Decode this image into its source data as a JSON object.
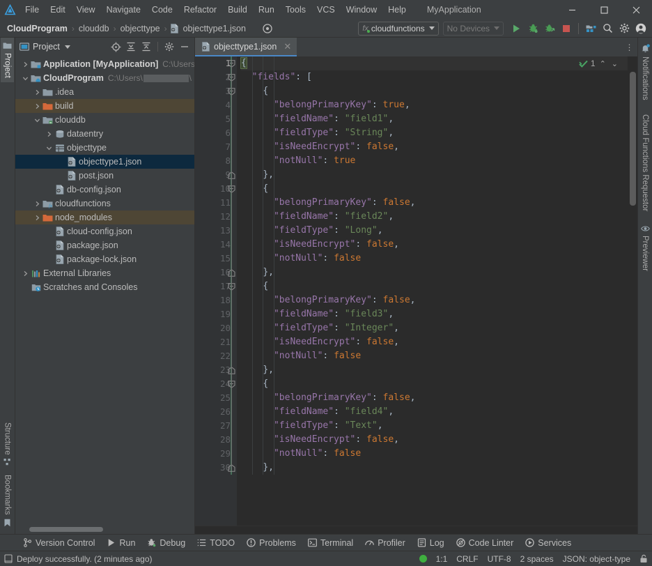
{
  "window": {
    "app_title": "MyApplication",
    "minimize_label": "—",
    "maximize_label": "□",
    "close_label": "✕"
  },
  "menu": {
    "items": [
      {
        "label": "File"
      },
      {
        "label": "Edit"
      },
      {
        "label": "View"
      },
      {
        "label": "Navigate"
      },
      {
        "label": "Code"
      },
      {
        "label": "Refactor"
      },
      {
        "label": "Build"
      },
      {
        "label": "Run"
      },
      {
        "label": "Tools"
      },
      {
        "label": "VCS"
      },
      {
        "label": "Window"
      },
      {
        "label": "Help"
      }
    ]
  },
  "navbar": {
    "breadcrumbs": [
      {
        "label": "CloudProgram",
        "bold": true,
        "icon": ""
      },
      {
        "label": "clouddb",
        "bold": false,
        "icon": ""
      },
      {
        "label": "objecttype",
        "bold": false,
        "icon": ""
      },
      {
        "label": "objecttype1.json",
        "bold": false,
        "icon": "json-file-icon"
      }
    ],
    "separator": "›",
    "run_config": "cloudfunctions",
    "run_config_prefix": "fx",
    "device_selector": "No Devices",
    "buttons": [
      {
        "name": "run-button",
        "icon": "run-icon"
      },
      {
        "name": "debug-button",
        "icon": "debug-icon"
      },
      {
        "name": "attach-debugger-button",
        "icon": "attach-debugger-icon"
      },
      {
        "name": "stop-button",
        "icon": "stop-icon"
      },
      {
        "name": "project-structure-button",
        "icon": "project-structure-icon"
      },
      {
        "name": "search-everywhere-button",
        "icon": "search-icon"
      },
      {
        "name": "settings-button",
        "icon": "gear-icon"
      },
      {
        "name": "account-button",
        "icon": "avatar-icon"
      }
    ]
  },
  "left_rail": {
    "top": [
      {
        "label": "Project",
        "active": true
      }
    ],
    "bottom": [
      {
        "label": "Structure",
        "active": false
      },
      {
        "label": "Bookmarks",
        "active": false
      }
    ]
  },
  "right_rail": {
    "items": [
      {
        "label": "Notifications"
      },
      {
        "label": "Cloud Functions Requestor"
      },
      {
        "label": "Previewer"
      }
    ]
  },
  "project_panel": {
    "title": "Project",
    "tools": [
      {
        "name": "select-opened-file-icon"
      },
      {
        "name": "expand-all-icon"
      },
      {
        "name": "collapse-all-icon"
      },
      {
        "name": "gear-icon"
      },
      {
        "name": "hide-panel-icon"
      }
    ],
    "tree": [
      {
        "indent": 0,
        "arrow": "right",
        "icon": "module-icon",
        "label": "Application [MyApplication]",
        "bold": true,
        "path": "C:\\Users",
        "state": "none",
        "redacted": false
      },
      {
        "indent": 0,
        "arrow": "down",
        "icon": "cloud-module-icon",
        "label": "CloudProgram",
        "bold": true,
        "path": "C:\\Users\\",
        "state": "none",
        "redacted": true
      },
      {
        "indent": 1,
        "arrow": "right",
        "icon": "folder-icon",
        "label": ".idea",
        "bold": false,
        "path": "",
        "state": "none",
        "redacted": false
      },
      {
        "indent": 1,
        "arrow": "right",
        "icon": "orange-folder-icon",
        "label": "build",
        "bold": false,
        "path": "",
        "state": "hl",
        "redacted": false
      },
      {
        "indent": 1,
        "arrow": "down",
        "icon": "db-module-icon",
        "label": "clouddb",
        "bold": false,
        "path": "",
        "state": "none",
        "redacted": false
      },
      {
        "indent": 2,
        "arrow": "right",
        "icon": "dataentry-icon",
        "label": "dataentry",
        "bold": false,
        "path": "",
        "state": "none",
        "redacted": false
      },
      {
        "indent": 2,
        "arrow": "down",
        "icon": "objecttype-icon",
        "label": "objecttype",
        "bold": false,
        "path": "",
        "state": "none",
        "redacted": false
      },
      {
        "indent": 3,
        "arrow": "none",
        "icon": "json-file-icon",
        "label": "objecttype1.json",
        "bold": false,
        "path": "",
        "state": "sel",
        "redacted": false
      },
      {
        "indent": 3,
        "arrow": "none",
        "icon": "json-file-icon",
        "label": "post.json",
        "bold": false,
        "path": "",
        "state": "none",
        "redacted": false
      },
      {
        "indent": 2,
        "arrow": "none",
        "icon": "json-file-icon",
        "label": "db-config.json",
        "bold": false,
        "path": "",
        "state": "none",
        "redacted": false
      },
      {
        "indent": 1,
        "arrow": "right",
        "icon": "fn-module-icon",
        "label": "cloudfunctions",
        "bold": false,
        "path": "",
        "state": "none",
        "redacted": false
      },
      {
        "indent": 1,
        "arrow": "right",
        "icon": "orange-folder-icon",
        "label": "node_modules",
        "bold": false,
        "path": "",
        "state": "hl",
        "redacted": false
      },
      {
        "indent": 2,
        "arrow": "none",
        "icon": "json-file-icon",
        "label": "cloud-config.json",
        "bold": false,
        "path": "",
        "state": "none",
        "redacted": false
      },
      {
        "indent": 2,
        "arrow": "none",
        "icon": "json-file-icon",
        "label": "package.json",
        "bold": false,
        "path": "",
        "state": "none",
        "redacted": false
      },
      {
        "indent": 2,
        "arrow": "none",
        "icon": "json-file-icon",
        "label": "package-lock.json",
        "bold": false,
        "path": "",
        "state": "none",
        "redacted": false
      },
      {
        "indent": 0,
        "arrow": "right",
        "icon": "libraries-icon",
        "label": "External Libraries",
        "bold": false,
        "path": "",
        "state": "none",
        "redacted": false
      },
      {
        "indent": 0,
        "arrow": "none",
        "icon": "scratches-icon",
        "label": "Scratches and Consoles",
        "bold": false,
        "path": "",
        "state": "none",
        "redacted": false
      }
    ]
  },
  "editor": {
    "tab": {
      "label": "objecttype1.json",
      "icon": "json-file-icon",
      "close": "✕"
    },
    "more_actions": "⋮",
    "inspections": {
      "count": "1",
      "icon": "inspection-ok-icon",
      "prev": "⌃",
      "next": "⌄"
    },
    "first_line_number": 1,
    "lines": [
      {
        "n": 1,
        "fold": "open",
        "tokens": [
          {
            "t": "{",
            "c": "p"
          }
        ],
        "indent": 0,
        "cursor": true
      },
      {
        "n": 2,
        "fold": "open",
        "tokens": [
          {
            "t": "\"fields\"",
            "c": "k"
          },
          {
            "t": ": ",
            "c": "p"
          },
          {
            "t": "[",
            "c": "p"
          }
        ],
        "indent": 1
      },
      {
        "n": 3,
        "fold": "open",
        "tokens": [
          {
            "t": "{",
            "c": "p"
          }
        ],
        "indent": 2
      },
      {
        "n": 4,
        "fold": "",
        "tokens": [
          {
            "t": "\"belongPrimaryKey\"",
            "c": "k"
          },
          {
            "t": ": ",
            "c": "p"
          },
          {
            "t": "true",
            "c": "b"
          },
          {
            "t": ",",
            "c": "p"
          }
        ],
        "indent": 3
      },
      {
        "n": 5,
        "fold": "",
        "tokens": [
          {
            "t": "\"fieldName\"",
            "c": "k"
          },
          {
            "t": ": ",
            "c": "p"
          },
          {
            "t": "\"field1\"",
            "c": "s"
          },
          {
            "t": ",",
            "c": "p"
          }
        ],
        "indent": 3
      },
      {
        "n": 6,
        "fold": "",
        "tokens": [
          {
            "t": "\"fieldType\"",
            "c": "k"
          },
          {
            "t": ": ",
            "c": "p"
          },
          {
            "t": "\"String\"",
            "c": "s"
          },
          {
            "t": ",",
            "c": "p"
          }
        ],
        "indent": 3
      },
      {
        "n": 7,
        "fold": "",
        "tokens": [
          {
            "t": "\"isNeedEncrypt\"",
            "c": "k"
          },
          {
            "t": ": ",
            "c": "p"
          },
          {
            "t": "false",
            "c": "b"
          },
          {
            "t": ",",
            "c": "p"
          }
        ],
        "indent": 3
      },
      {
        "n": 8,
        "fold": "",
        "tokens": [
          {
            "t": "\"notNull\"",
            "c": "k"
          },
          {
            "t": ": ",
            "c": "p"
          },
          {
            "t": "true",
            "c": "b"
          }
        ],
        "indent": 3
      },
      {
        "n": 9,
        "fold": "close",
        "tokens": [
          {
            "t": "},",
            "c": "p"
          }
        ],
        "indent": 2
      },
      {
        "n": 10,
        "fold": "open",
        "tokens": [
          {
            "t": "{",
            "c": "p"
          }
        ],
        "indent": 2
      },
      {
        "n": 11,
        "fold": "",
        "tokens": [
          {
            "t": "\"belongPrimaryKey\"",
            "c": "k"
          },
          {
            "t": ": ",
            "c": "p"
          },
          {
            "t": "false",
            "c": "b"
          },
          {
            "t": ",",
            "c": "p"
          }
        ],
        "indent": 3
      },
      {
        "n": 12,
        "fold": "",
        "tokens": [
          {
            "t": "\"fieldName\"",
            "c": "k"
          },
          {
            "t": ": ",
            "c": "p"
          },
          {
            "t": "\"field2\"",
            "c": "s"
          },
          {
            "t": ",",
            "c": "p"
          }
        ],
        "indent": 3
      },
      {
        "n": 13,
        "fold": "",
        "tokens": [
          {
            "t": "\"fieldType\"",
            "c": "k"
          },
          {
            "t": ": ",
            "c": "p"
          },
          {
            "t": "\"Long\"",
            "c": "s"
          },
          {
            "t": ",",
            "c": "p"
          }
        ],
        "indent": 3
      },
      {
        "n": 14,
        "fold": "",
        "tokens": [
          {
            "t": "\"isNeedEncrypt\"",
            "c": "k"
          },
          {
            "t": ": ",
            "c": "p"
          },
          {
            "t": "false",
            "c": "b"
          },
          {
            "t": ",",
            "c": "p"
          }
        ],
        "indent": 3
      },
      {
        "n": 15,
        "fold": "",
        "tokens": [
          {
            "t": "\"notNull\"",
            "c": "k"
          },
          {
            "t": ": ",
            "c": "p"
          },
          {
            "t": "false",
            "c": "b"
          }
        ],
        "indent": 3
      },
      {
        "n": 16,
        "fold": "close",
        "tokens": [
          {
            "t": "},",
            "c": "p"
          }
        ],
        "indent": 2
      },
      {
        "n": 17,
        "fold": "open",
        "tokens": [
          {
            "t": "{",
            "c": "p"
          }
        ],
        "indent": 2
      },
      {
        "n": 18,
        "fold": "",
        "tokens": [
          {
            "t": "\"belongPrimaryKey\"",
            "c": "k"
          },
          {
            "t": ": ",
            "c": "p"
          },
          {
            "t": "false",
            "c": "b"
          },
          {
            "t": ",",
            "c": "p"
          }
        ],
        "indent": 3
      },
      {
        "n": 19,
        "fold": "",
        "tokens": [
          {
            "t": "\"fieldName\"",
            "c": "k"
          },
          {
            "t": ": ",
            "c": "p"
          },
          {
            "t": "\"field3\"",
            "c": "s"
          },
          {
            "t": ",",
            "c": "p"
          }
        ],
        "indent": 3
      },
      {
        "n": 20,
        "fold": "",
        "tokens": [
          {
            "t": "\"fieldType\"",
            "c": "k"
          },
          {
            "t": ": ",
            "c": "p"
          },
          {
            "t": "\"Integer\"",
            "c": "s"
          },
          {
            "t": ",",
            "c": "p"
          }
        ],
        "indent": 3
      },
      {
        "n": 21,
        "fold": "",
        "tokens": [
          {
            "t": "\"isNeedEncrypt\"",
            "c": "k"
          },
          {
            "t": ": ",
            "c": "p"
          },
          {
            "t": "false",
            "c": "b"
          },
          {
            "t": ",",
            "c": "p"
          }
        ],
        "indent": 3
      },
      {
        "n": 22,
        "fold": "",
        "tokens": [
          {
            "t": "\"notNull\"",
            "c": "k"
          },
          {
            "t": ": ",
            "c": "p"
          },
          {
            "t": "false",
            "c": "b"
          }
        ],
        "indent": 3
      },
      {
        "n": 23,
        "fold": "close",
        "tokens": [
          {
            "t": "},",
            "c": "p"
          }
        ],
        "indent": 2
      },
      {
        "n": 24,
        "fold": "open",
        "tokens": [
          {
            "t": "{",
            "c": "p"
          }
        ],
        "indent": 2
      },
      {
        "n": 25,
        "fold": "",
        "tokens": [
          {
            "t": "\"belongPrimaryKey\"",
            "c": "k"
          },
          {
            "t": ": ",
            "c": "p"
          },
          {
            "t": "false",
            "c": "b"
          },
          {
            "t": ",",
            "c": "p"
          }
        ],
        "indent": 3
      },
      {
        "n": 26,
        "fold": "",
        "tokens": [
          {
            "t": "\"fieldName\"",
            "c": "k"
          },
          {
            "t": ": ",
            "c": "p"
          },
          {
            "t": "\"field4\"",
            "c": "s"
          },
          {
            "t": ",",
            "c": "p"
          }
        ],
        "indent": 3
      },
      {
        "n": 27,
        "fold": "",
        "tokens": [
          {
            "t": "\"fieldType\"",
            "c": "k"
          },
          {
            "t": ": ",
            "c": "p"
          },
          {
            "t": "\"Text\"",
            "c": "s"
          },
          {
            "t": ",",
            "c": "p"
          }
        ],
        "indent": 3
      },
      {
        "n": 28,
        "fold": "",
        "tokens": [
          {
            "t": "\"isNeedEncrypt\"",
            "c": "k"
          },
          {
            "t": ": ",
            "c": "p"
          },
          {
            "t": "false",
            "c": "b"
          },
          {
            "t": ",",
            "c": "p"
          }
        ],
        "indent": 3
      },
      {
        "n": 29,
        "fold": "",
        "tokens": [
          {
            "t": "\"notNull\"",
            "c": "k"
          },
          {
            "t": ": ",
            "c": "p"
          },
          {
            "t": "false",
            "c": "b"
          }
        ],
        "indent": 3
      },
      {
        "n": 30,
        "fold": "close",
        "tokens": [
          {
            "t": "},",
            "c": "p"
          }
        ],
        "indent": 2
      }
    ]
  },
  "toolwindows": [
    {
      "label": "Version Control",
      "icon": "branch-icon"
    },
    {
      "label": "Run",
      "icon": "run-icon"
    },
    {
      "label": "Debug",
      "icon": "debug-icon"
    },
    {
      "label": "TODO",
      "icon": "todo-icon"
    },
    {
      "label": "Problems",
      "icon": "problems-icon"
    },
    {
      "label": "Terminal",
      "icon": "terminal-icon"
    },
    {
      "label": "Profiler",
      "icon": "profiler-icon"
    },
    {
      "label": "Log",
      "icon": "log-icon"
    },
    {
      "label": "Code Linter",
      "icon": "linter-icon"
    },
    {
      "label": "Services",
      "icon": "services-icon"
    }
  ],
  "statusbar": {
    "message": "Deploy successfully. (2 minutes ago)",
    "message_icon": "notification-icon",
    "status_dot_color": "#3fae3f",
    "caret_position": "1:1",
    "line_separator": "CRLF",
    "encoding": "UTF-8",
    "indent": "2 spaces",
    "file_type": "JSON: object-type",
    "lock_icon": "lock-icon"
  },
  "colors": {
    "bg_panel": "#3c3f41",
    "bg_editor": "#2b2b2b",
    "accent_tab": "#4a88c7",
    "selection": "#0d293e",
    "key": "#9876aa",
    "string": "#6a8759",
    "boolean": "#cc7832",
    "punct": "#a9b7c6"
  }
}
